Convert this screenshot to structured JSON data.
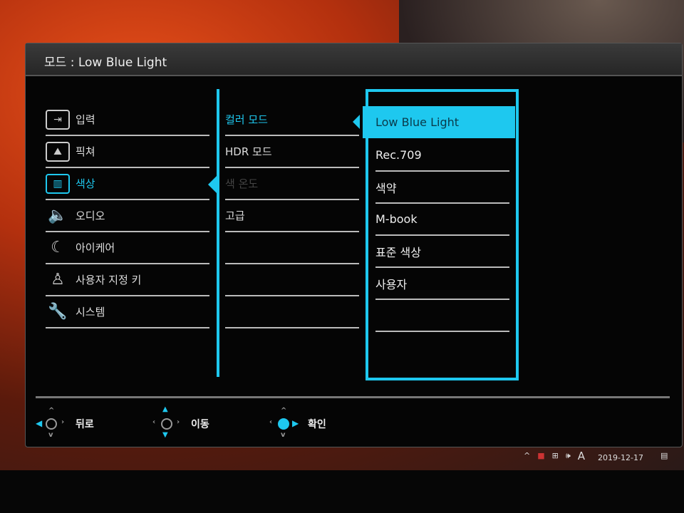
{
  "header": {
    "label": "모드",
    "value": "Low Blue Light"
  },
  "main_menu": [
    {
      "label": "입력",
      "icon": "input-icon"
    },
    {
      "label": "픽쳐",
      "icon": "picture-icon"
    },
    {
      "label": "색상",
      "icon": "color-icon",
      "selected": true
    },
    {
      "label": "오디오",
      "icon": "speaker-icon"
    },
    {
      "label": "아이케어",
      "icon": "eyecare-icon"
    },
    {
      "label": "사용자 지정 키",
      "icon": "user-icon"
    },
    {
      "label": "시스템",
      "icon": "wrench-icon"
    }
  ],
  "sub_menu": [
    {
      "label": "컬러 모드",
      "selected": true
    },
    {
      "label": "HDR 모드"
    },
    {
      "label": "색 온도",
      "disabled": true
    },
    {
      "label": "고급"
    }
  ],
  "options": [
    {
      "label": "Low Blue Light",
      "highlighted": true
    },
    {
      "label": "Rec.709"
    },
    {
      "label": "색약"
    },
    {
      "label": "M-book"
    },
    {
      "label": "표준 색상"
    },
    {
      "label": "사용자"
    }
  ],
  "footer": {
    "back": "뒤로",
    "move": "이동",
    "confirm": "확인"
  },
  "taskbar": {
    "ime": "A",
    "date": "2019-12-17"
  },
  "accent": "#1ec8ef"
}
